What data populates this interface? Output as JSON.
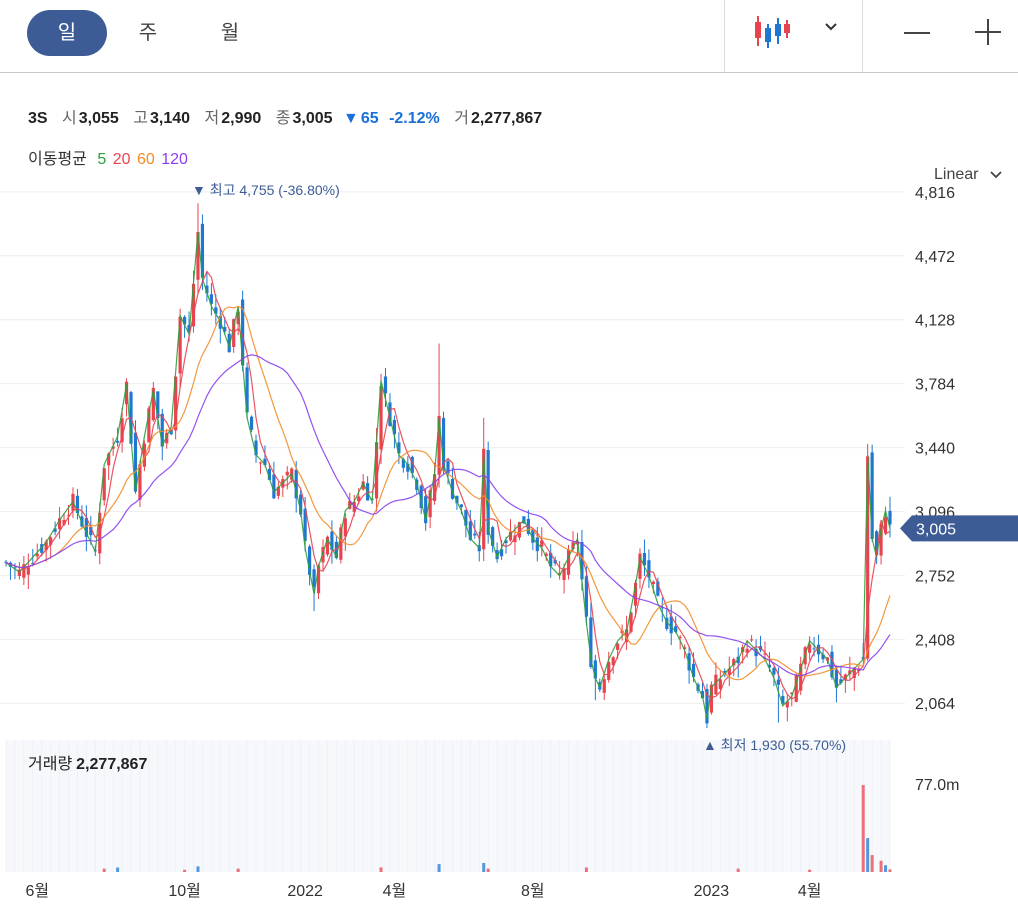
{
  "toolbar": {
    "periods": [
      {
        "label": "일",
        "active": true
      },
      {
        "label": "주",
        "active": false
      },
      {
        "label": "월",
        "active": false
      }
    ],
    "chart_type_icon": "candlestick-icon",
    "dropdown_icon": "chevron-down-icon",
    "zoom_out_icon": "minus-icon",
    "zoom_in_icon": "plus-icon"
  },
  "quote": {
    "symbol": "3S",
    "open_label": "시",
    "open": "3,055",
    "high_label": "고",
    "high": "3,140",
    "low_label": "저",
    "low": "2,990",
    "close_label": "종",
    "close": "3,005",
    "change_arrow": "▼",
    "change": "65",
    "change_pct": "-2.12%",
    "volume_label": "거",
    "volume": "2,277,867"
  },
  "moving_average": {
    "label": "이동평균",
    "periods": [
      {
        "value": "5",
        "color": "#2e9e3a"
      },
      {
        "value": "20",
        "color": "#e8434f"
      },
      {
        "value": "60",
        "color": "#f28c28"
      },
      {
        "value": "120",
        "color": "#8a3ff0"
      }
    ]
  },
  "scale": {
    "label": "Linear"
  },
  "volume_panel": {
    "label": "거래량",
    "value": "2,277,867",
    "axis_label": "77.0m"
  },
  "colors": {
    "up": "#e8434f",
    "down": "#1e78d2",
    "price_badge": "#3d5c96",
    "annotation": "#3d5c96"
  },
  "chart_data": {
    "type": "candlestick",
    "y_ticks": [
      "4,816",
      "4,472",
      "4,128",
      "3,784",
      "3,440",
      "3,096",
      "2,752",
      "2,408",
      "2,064"
    ],
    "y_tick_values": [
      4816,
      4472,
      4128,
      3784,
      3440,
      3096,
      2752,
      2408,
      2064
    ],
    "ylim": [
      1920,
      4880
    ],
    "x_tick_labels": [
      "6월",
      "10월",
      "2022",
      "4월",
      "8월",
      "2023",
      "4월"
    ],
    "last_price_label": "3,005",
    "last_price": 3005,
    "high_annotation": {
      "arrow": "▼",
      "label": "최고",
      "value": "4,755",
      "pct": "(-36.80%)"
    },
    "low_annotation": {
      "arrow": "▲",
      "label": "최저",
      "value": "1,930",
      "pct": "(55.70%)"
    },
    "close_series": [
      {
        "x": 0,
        "y": 2820
      },
      {
        "x": 3,
        "y": 2770
      },
      {
        "x": 6,
        "y": 2850
      },
      {
        "x": 9,
        "y": 2930
      },
      {
        "x": 12,
        "y": 3050
      },
      {
        "x": 15,
        "y": 3150
      },
      {
        "x": 18,
        "y": 2980
      },
      {
        "x": 20,
        "y": 2880
      },
      {
        "x": 22,
        "y": 3350
      },
      {
        "x": 25,
        "y": 3500
      },
      {
        "x": 27,
        "y": 3780
      },
      {
        "x": 29,
        "y": 3200
      },
      {
        "x": 31,
        "y": 3500
      },
      {
        "x": 33,
        "y": 3750
      },
      {
        "x": 35,
        "y": 3450
      },
      {
        "x": 37,
        "y": 3550
      },
      {
        "x": 39,
        "y": 4150
      },
      {
        "x": 41,
        "y": 4050
      },
      {
        "x": 43,
        "y": 4600
      },
      {
        "x": 44,
        "y": 4350
      },
      {
        "x": 46,
        "y": 4200
      },
      {
        "x": 48,
        "y": 4120
      },
      {
        "x": 50,
        "y": 3980
      },
      {
        "x": 52,
        "y": 4200
      },
      {
        "x": 54,
        "y": 3600
      },
      {
        "x": 56,
        "y": 3400
      },
      {
        "x": 58,
        "y": 3350
      },
      {
        "x": 60,
        "y": 3200
      },
      {
        "x": 62,
        "y": 3250
      },
      {
        "x": 64,
        "y": 3300
      },
      {
        "x": 66,
        "y": 3100
      },
      {
        "x": 67,
        "y": 2900
      },
      {
        "x": 69,
        "y": 2650
      },
      {
        "x": 70,
        "y": 2800
      },
      {
        "x": 72,
        "y": 2950
      },
      {
        "x": 74,
        "y": 2850
      },
      {
        "x": 76,
        "y": 3100
      },
      {
        "x": 78,
        "y": 3150
      },
      {
        "x": 80,
        "y": 3250
      },
      {
        "x": 82,
        "y": 3150
      },
      {
        "x": 84,
        "y": 3800
      },
      {
        "x": 86,
        "y": 3600
      },
      {
        "x": 88,
        "y": 3400
      },
      {
        "x": 90,
        "y": 3350
      },
      {
        "x": 92,
        "y": 3250
      },
      {
        "x": 94,
        "y": 3050
      },
      {
        "x": 96,
        "y": 3300
      },
      {
        "x": 97,
        "y": 3600
      },
      {
        "x": 98,
        "y": 3350
      },
      {
        "x": 100,
        "y": 3200
      },
      {
        "x": 102,
        "y": 3100
      },
      {
        "x": 104,
        "y": 2950
      },
      {
        "x": 106,
        "y": 2900
      },
      {
        "x": 107,
        "y": 3400
      },
      {
        "x": 108,
        "y": 3000
      },
      {
        "x": 110,
        "y": 2850
      },
      {
        "x": 112,
        "y": 2950
      },
      {
        "x": 114,
        "y": 3000
      },
      {
        "x": 116,
        "y": 3050
      },
      {
        "x": 118,
        "y": 2950
      },
      {
        "x": 120,
        "y": 2900
      },
      {
        "x": 122,
        "y": 2800
      },
      {
        "x": 124,
        "y": 2750
      },
      {
        "x": 126,
        "y": 2850
      },
      {
        "x": 128,
        "y": 2950
      },
      {
        "x": 130,
        "y": 2500
      },
      {
        "x": 131,
        "y": 2300
      },
      {
        "x": 132,
        "y": 2200
      },
      {
        "x": 133,
        "y": 2150
      },
      {
        "x": 135,
        "y": 2300
      },
      {
        "x": 137,
        "y": 2400
      },
      {
        "x": 139,
        "y": 2450
      },
      {
        "x": 141,
        "y": 2700
      },
      {
        "x": 142,
        "y": 2850
      },
      {
        "x": 144,
        "y": 2750
      },
      {
        "x": 146,
        "y": 2600
      },
      {
        "x": 148,
        "y": 2500
      },
      {
        "x": 150,
        "y": 2450
      },
      {
        "x": 152,
        "y": 2350
      },
      {
        "x": 154,
        "y": 2200
      },
      {
        "x": 156,
        "y": 2100
      },
      {
        "x": 157,
        "y": 1980
      },
      {
        "x": 158,
        "y": 2150
      },
      {
        "x": 160,
        "y": 2200
      },
      {
        "x": 162,
        "y": 2250
      },
      {
        "x": 164,
        "y": 2300
      },
      {
        "x": 166,
        "y": 2400
      },
      {
        "x": 168,
        "y": 2350
      },
      {
        "x": 170,
        "y": 2300
      },
      {
        "x": 172,
        "y": 2200
      },
      {
        "x": 174,
        "y": 2050
      },
      {
        "x": 176,
        "y": 2100
      },
      {
        "x": 178,
        "y": 2250
      },
      {
        "x": 180,
        "y": 2400
      },
      {
        "x": 182,
        "y": 2350
      },
      {
        "x": 184,
        "y": 2300
      },
      {
        "x": 186,
        "y": 2150
      },
      {
        "x": 188,
        "y": 2200
      },
      {
        "x": 190,
        "y": 2250
      },
      {
        "x": 192,
        "y": 2300
      },
      {
        "x": 193,
        "y": 3400
      },
      {
        "x": 194,
        "y": 2950
      },
      {
        "x": 195,
        "y": 2850
      },
      {
        "x": 196,
        "y": 3000
      },
      {
        "x": 197,
        "y": 3100
      },
      {
        "x": 198,
        "y": 3005
      }
    ],
    "high_series": [
      {
        "x": 43,
        "y": 4755
      },
      {
        "x": 97,
        "y": 4000
      },
      {
        "x": 107,
        "y": 3600
      },
      {
        "x": 193,
        "y": 3460
      }
    ],
    "low_series": [
      {
        "x": 69,
        "y": 2560
      },
      {
        "x": 132,
        "y": 2080
      },
      {
        "x": 157,
        "y": 1930
      },
      {
        "x": 173,
        "y": 1960
      }
    ],
    "volume_series": [
      {
        "x": 22,
        "y": 3
      },
      {
        "x": 25,
        "y": 4
      },
      {
        "x": 40,
        "y": 2
      },
      {
        "x": 43,
        "y": 5
      },
      {
        "x": 52,
        "y": 3
      },
      {
        "x": 84,
        "y": 4
      },
      {
        "x": 97,
        "y": 7
      },
      {
        "x": 107,
        "y": 8
      },
      {
        "x": 108,
        "y": 3
      },
      {
        "x": 130,
        "y": 4
      },
      {
        "x": 164,
        "y": 3
      },
      {
        "x": 180,
        "y": 2
      },
      {
        "x": 192,
        "y": 77
      },
      {
        "x": 193,
        "y": 30
      },
      {
        "x": 194,
        "y": 15
      },
      {
        "x": 196,
        "y": 10
      },
      {
        "x": 197,
        "y": 6
      },
      {
        "x": 198,
        "y": 2.3
      }
    ],
    "volume_axis_max": 77,
    "x_tick_positions": [
      7,
      40,
      67,
      87,
      118,
      158,
      180
    ]
  }
}
